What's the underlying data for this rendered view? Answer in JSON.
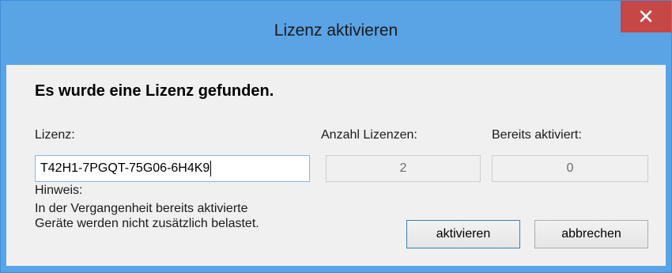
{
  "window": {
    "title": "Lizenz aktivieren",
    "close_glyph": "✕"
  },
  "content": {
    "heading": "Es wurde eine Lizenz gefunden.",
    "license_label": "Lizenz:",
    "license_value": "T42H1-7PGQT-75G06-6H4K9",
    "count_label": "Anzahl Lizenzen:",
    "count_value": "2",
    "activated_label": "Bereits aktiviert:",
    "activated_value": "0",
    "hint_title": "Hinweis:",
    "hint_line1": "In der Vergangenheit bereits aktivierte",
    "hint_line2": "Geräte werden nicht zusätzlich belastet."
  },
  "buttons": {
    "activate_label": "aktivieren",
    "cancel_label": "abbrechen"
  },
  "colors": {
    "titlebar": "#5aa3e5",
    "close_button": "#c74646",
    "client_background": "#f0f0f0"
  }
}
